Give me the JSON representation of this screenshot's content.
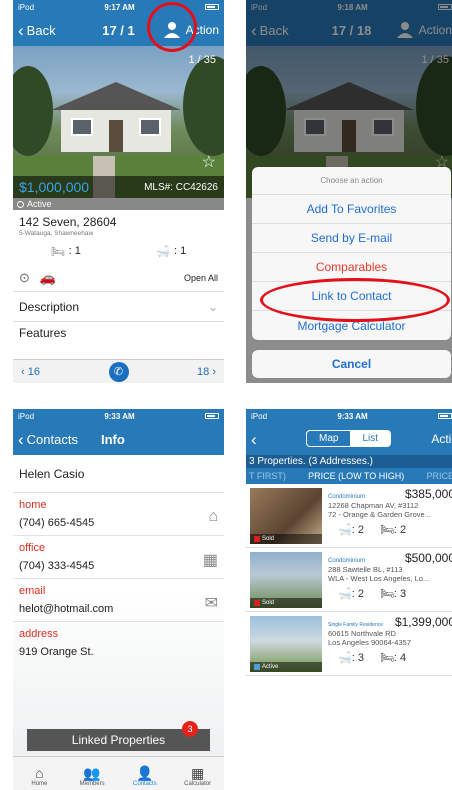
{
  "screen1": {
    "status": {
      "device": "iPod",
      "time": "9:17 AM"
    },
    "nav": {
      "back": "Back",
      "title": "17 / 1",
      "action": "Action"
    },
    "counter": "1 / 35",
    "price": "$1,000,000",
    "mls": "MLS#: CC42626",
    "status_label": "Active",
    "address_line1": "142 Seven, 28604",
    "address_line2": "5-Watauga, Shawneehaw",
    "beds": ": 1",
    "baths": ": 1",
    "open_all": "Open All",
    "description": "Description",
    "features": "Features",
    "prev": "16",
    "next": "18"
  },
  "screen2": {
    "status": {
      "device": "iPod",
      "time": "9:18 AM"
    },
    "nav": {
      "back": "Back",
      "title": "17 / 18",
      "action": "Action"
    },
    "counter": "1 / 35",
    "sheet": {
      "header": "Choose an action",
      "options": [
        "Add To Favorites",
        "Send by E-mail",
        "Comparables",
        "Link to Contact",
        "Mortgage Calculator"
      ],
      "cancel": "Cancel"
    }
  },
  "screen3": {
    "status": {
      "device": "iPod",
      "time": "9:33 AM"
    },
    "nav": {
      "back": "Contacts",
      "title": "Info"
    },
    "name": "Helen Casio",
    "fields": [
      {
        "label": "home",
        "value": "(704) 665-4545"
      },
      {
        "label": "office",
        "value": "(704) 333-4545"
      },
      {
        "label": "email",
        "value": "helot@hotmail.com"
      },
      {
        "label": "address",
        "value": "919 Orange St."
      }
    ],
    "linked": "Linked Properties",
    "badge": "3",
    "tabs": [
      "Home",
      "Members",
      "Contacts",
      "Calculator"
    ]
  },
  "screen4": {
    "status": {
      "device": "iPod",
      "time": "9:33 AM"
    },
    "seg": {
      "map": "Map",
      "list": "List"
    },
    "action": "Actio",
    "summary": "3 Properties. (3 Addresses.)",
    "sort": {
      "left": "T FIRST)",
      "active": "PRICE (LOW TO HIGH)",
      "right": "PRICE"
    },
    "listings": [
      {
        "type": "Condominium",
        "price": "$385,000",
        "line1": "12268 Chapman AV, #3112",
        "line2": "72 - Orange & Garden Grove...",
        "baths": ": 2",
        "beds": ": 2",
        "status": "Sold"
      },
      {
        "type": "Condominium",
        "price": "$500,000",
        "line1": "288  Sawtelle BL, #113",
        "line2": "WLA - West Los Angeles, Lo...",
        "baths": ": 2",
        "beds": ": 3",
        "status": "Sold"
      },
      {
        "type": "Single Family Residence",
        "price": "$1,399,000",
        "line1": "60615 Northvale RD",
        "line2": "Los Angeles 90064-4357",
        "baths": ": 3",
        "beds": ": 4",
        "status": "Active"
      }
    ]
  },
  "colors": {
    "nav_blue": "#2879b8",
    "price_blue": "#3aa4e6",
    "action_blue": "#1f6fd1",
    "destructive_red": "#e43a2a",
    "highlight_ring": "#e2101a"
  }
}
